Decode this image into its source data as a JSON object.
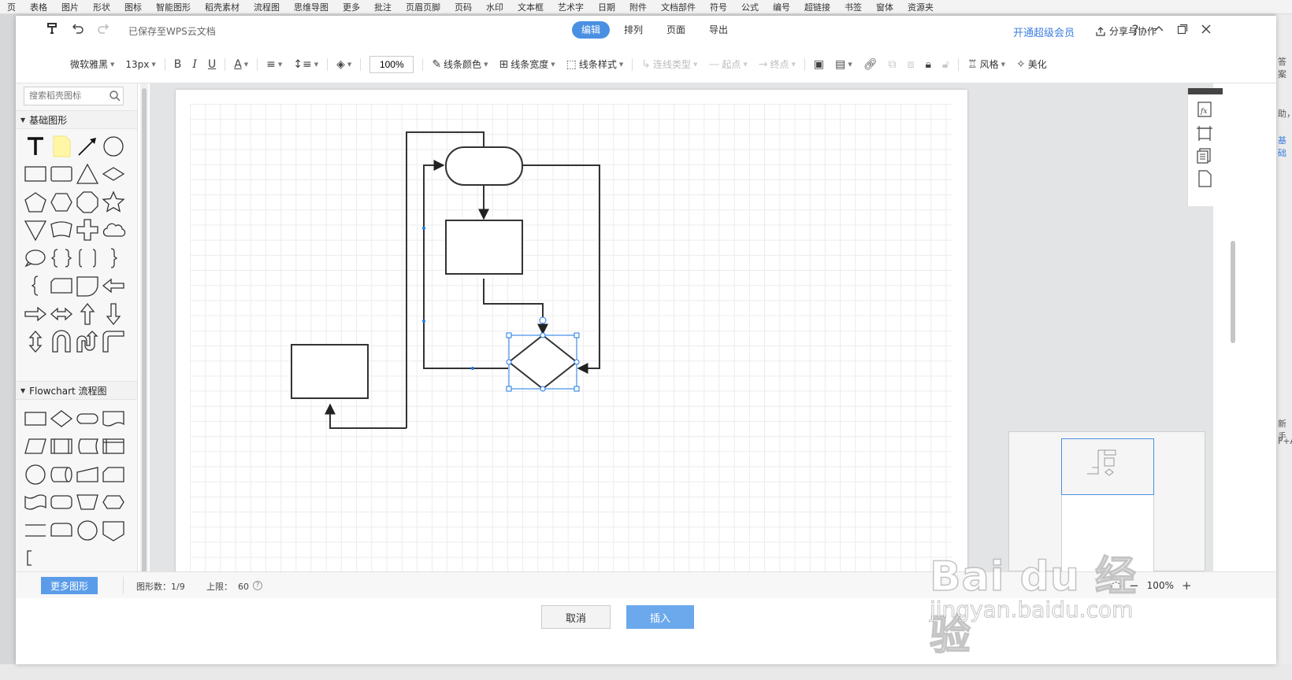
{
  "host": {
    "ribbon_items": [
      "页",
      "表格",
      "图片",
      "形状",
      "图标",
      "智能图形",
      "稻壳素材",
      "流程图",
      "思维导图",
      "更多",
      "批注",
      "页眉页脚",
      "页码",
      "水印",
      "文本框",
      "艺术字",
      "日期",
      "附件",
      "文档部件",
      "符号",
      "公式",
      "编号",
      "超链接",
      "书签",
      "窗体",
      "资源夹"
    ],
    "right_fragments": [
      "答案",
      "助，",
      "基础",
      "新手",
      "F+A"
    ]
  },
  "topbar": {
    "save_status": "已保存至WPS云文档",
    "tabs": [
      {
        "label": "编辑",
        "active": true
      },
      {
        "label": "排列",
        "active": false
      },
      {
        "label": "页面",
        "active": false
      },
      {
        "label": "导出",
        "active": false
      }
    ],
    "vip_link": "开通超级会员",
    "share_label": "分享与协作"
  },
  "toolbar": {
    "font_family": "微软雅黑",
    "font_size": "13px",
    "zoom_value": "100%",
    "line_color": "线条颜色",
    "line_width": "线条宽度",
    "line_style": "线条样式",
    "connector_type": "连线类型",
    "start_point": "起点",
    "end_point": "终点",
    "style_label": "风格",
    "beautify_label": "美化"
  },
  "left_panel": {
    "search_placeholder": "搜索稻壳图标",
    "basic_category": "基础图形",
    "flowchart_category": "Flowchart 流程图",
    "third_category": "…"
  },
  "status": {
    "more_shapes": "更多图形",
    "shape_count_label": "图形数：",
    "shape_count_value": "1/9",
    "limit_label": "上限：",
    "limit_value": "60",
    "zoom_value": "100%"
  },
  "footer": {
    "cancel": "取消",
    "insert": "插入"
  },
  "watermark": {
    "logo": "Bai du 经验",
    "url": "jingyan.baidu.com"
  },
  "colors": {
    "accent": "#4a90e2",
    "selection": "#1e78e6"
  }
}
